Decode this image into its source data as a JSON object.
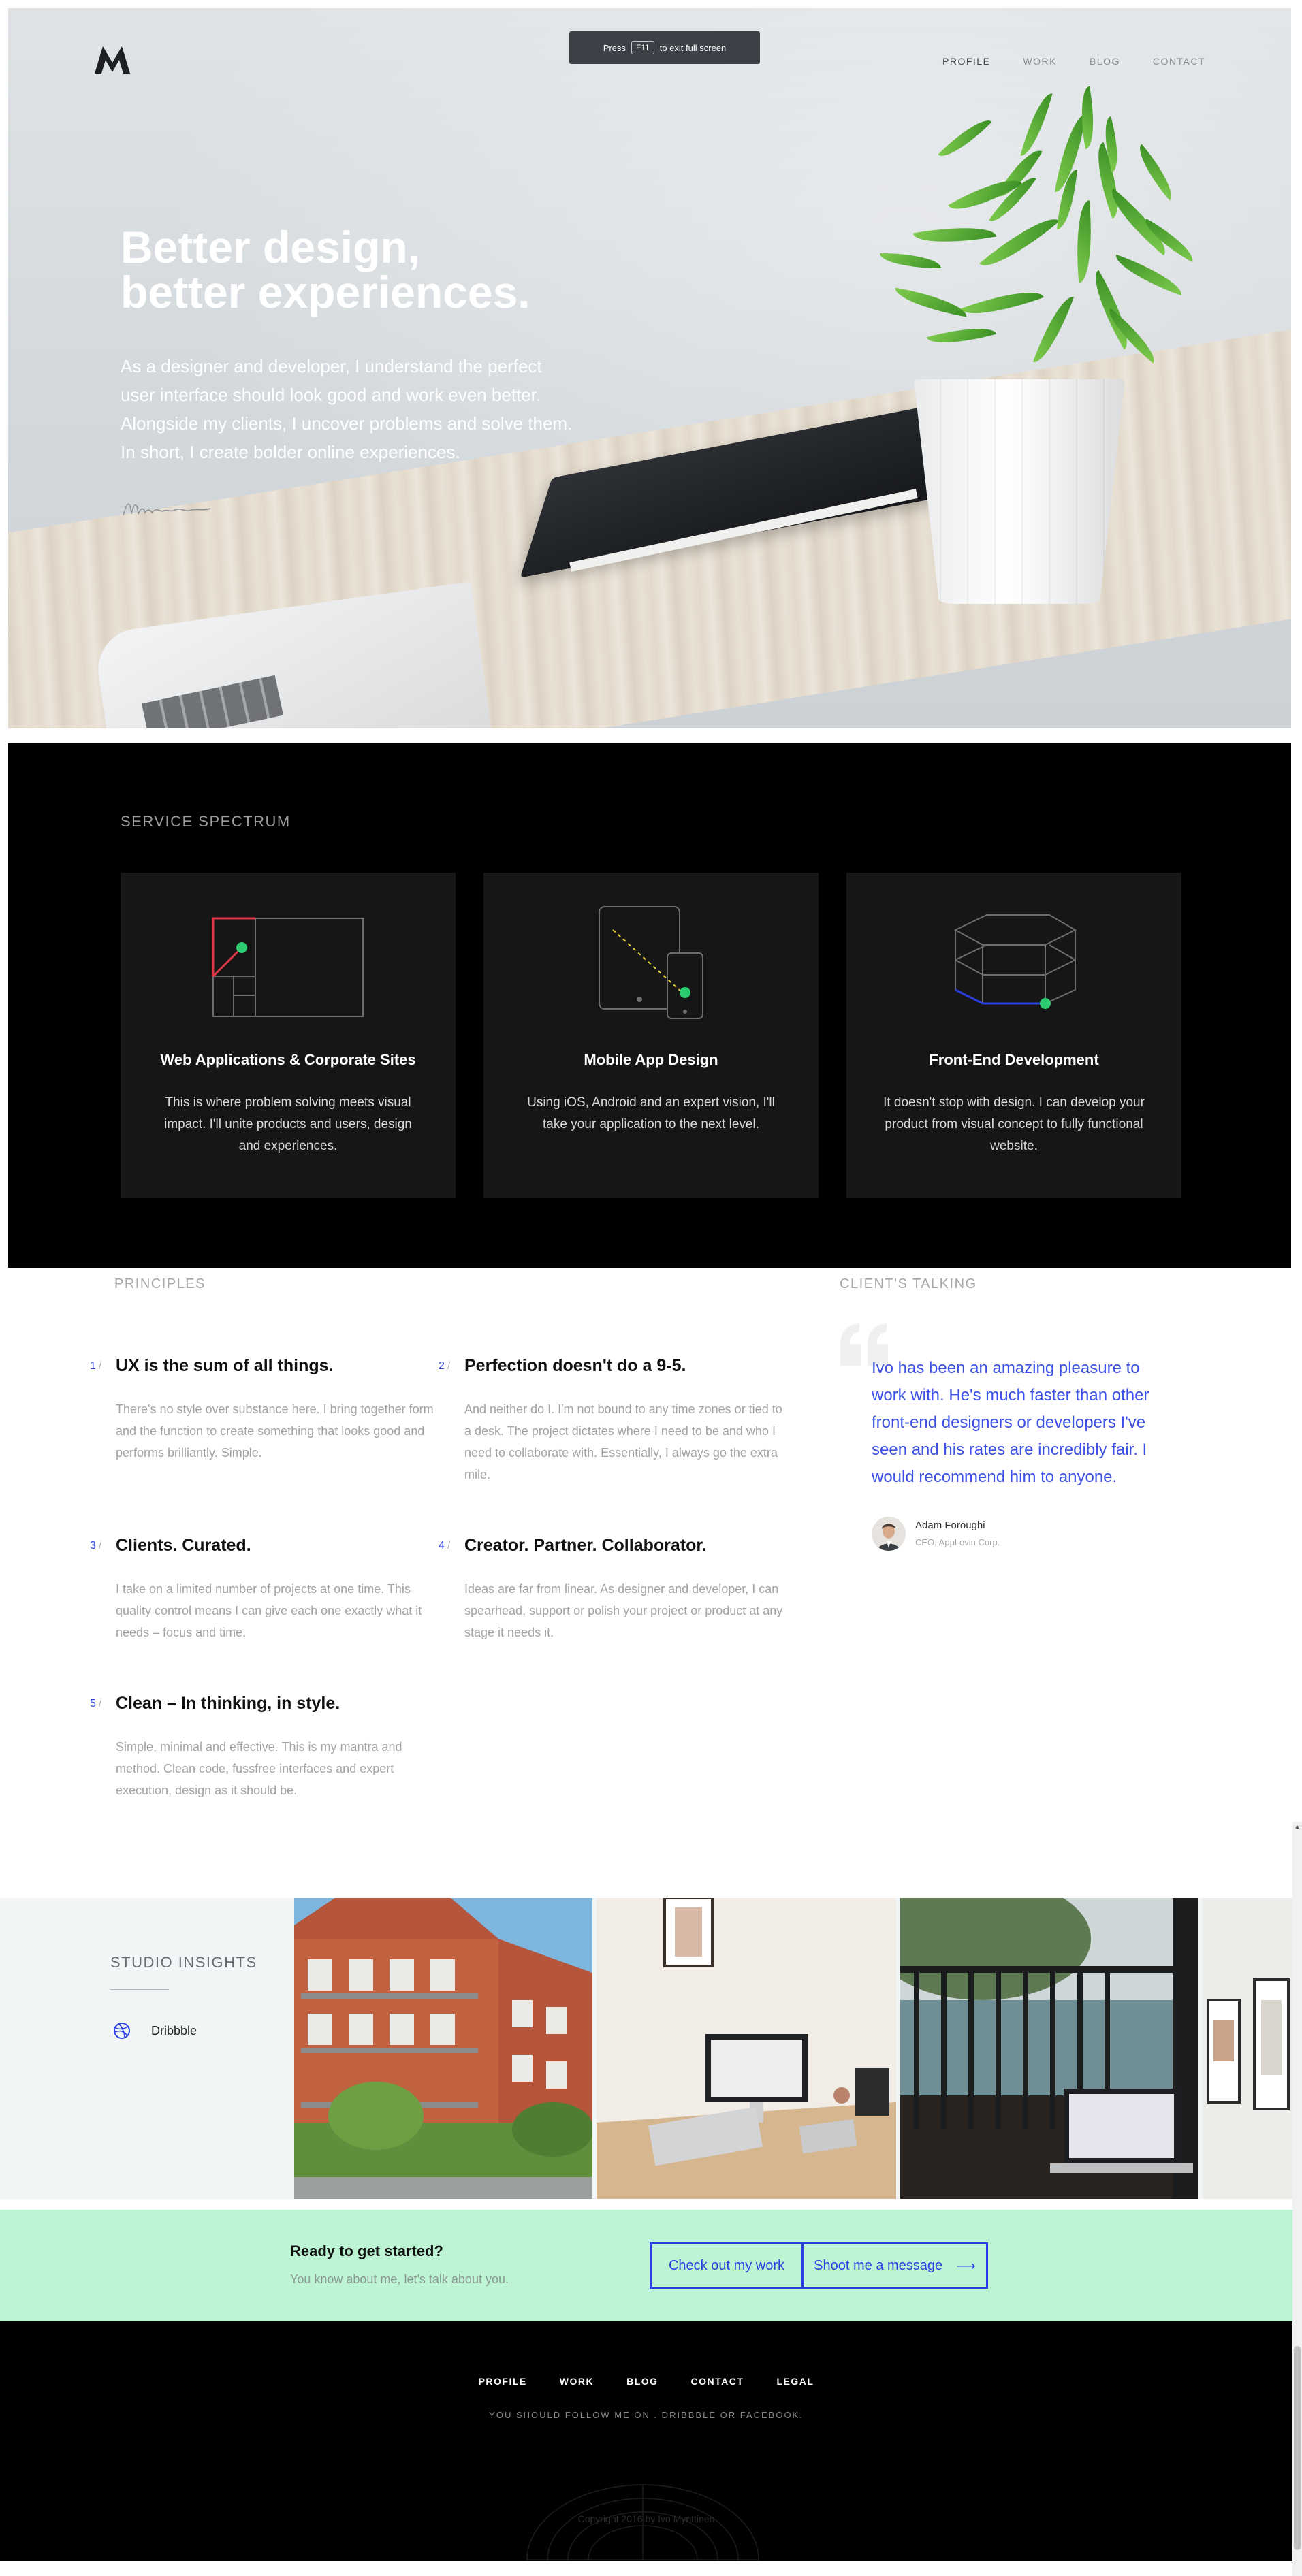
{
  "fullscreen_notice": {
    "prefix": "Press",
    "key": "F11",
    "suffix": "to exit full screen"
  },
  "nav": {
    "items": [
      "PROFILE",
      "WORK",
      "BLOG",
      "CONTACT"
    ],
    "active": "PROFILE"
  },
  "hero": {
    "title_lines": [
      "Better design,",
      "better experiences."
    ],
    "body_lines": [
      "As a designer and developer, I understand the perfect",
      "user interface should look good and work even better.",
      "Alongside my clients, I uncover problems and solve them.",
      "In short, I create bolder online experiences."
    ]
  },
  "services": {
    "title": "SERVICE SPECTRUM",
    "cards": [
      {
        "icon": "web-layout-icon",
        "name": "Web Applications & Corporate Sites",
        "desc": "This is where problem solving meets visual impact. I'll unite products and users, design and experiences."
      },
      {
        "icon": "devices-icon",
        "name": "Mobile App Design",
        "desc": "Using iOS, Android and an expert vision, I'll take your application to the next level."
      },
      {
        "icon": "cube-icon",
        "name": "Front-End Development",
        "desc": "It doesn't stop with design. I can develop your product from visual concept to fully functional website."
      }
    ]
  },
  "principles": {
    "title": "PRINCIPLES",
    "items": [
      {
        "num": "1",
        "sep": "/",
        "title": "UX is the sum of all things.",
        "body": "There's no style over substance here. I bring together form and the function to create something that looks good and performs brilliantly. Simple."
      },
      {
        "num": "2",
        "sep": "/",
        "title": "Perfection doesn't do a 9-5.",
        "body": "And neither do I. I'm not bound to any time zones or tied to a desk. The project dictates where I need to be and who I need to collaborate with. Essentially, I always go the extra mile."
      },
      {
        "num": "3",
        "sep": "/",
        "title": "Clients. Curated.",
        "body": "I take on a limited number of projects at one time. This quality control means I can give each one exactly what it needs – focus and time."
      },
      {
        "num": "4",
        "sep": "/",
        "title": "Creator. Partner. Collaborator.",
        "body": "Ideas are far from linear. As designer and developer, I can spearhead, support or polish your project or product at any stage it needs it."
      },
      {
        "num": "5",
        "sep": "/",
        "title": "Clean – In thinking, in style.",
        "body": "Simple, minimal and effective. This is my mantra and method. Clean code, fussfree interfaces and expert execution, design as it should be."
      }
    ]
  },
  "testimonial": {
    "title": "CLIENT'S TALKING",
    "quote": "Ivo has been an amazing pleasure to work with. He's much faster than other front-end designers or developers I've seen and his rates are incredibly fair. I would recommend him to anyone.",
    "author": "Adam Foroughi",
    "role": "CEO, AppLovin Corp."
  },
  "insights": {
    "title": "STUDIO INSIGHTS",
    "link": "Dribbble"
  },
  "cta": {
    "title": "Ready to get started?",
    "subtitle": "You know about me, let's talk about you.",
    "button_work": "Check out my work",
    "button_message": "Shoot me a message",
    "arrow": "⟶"
  },
  "footer": {
    "nav": [
      "PROFILE",
      "WORK",
      "BLOG",
      "CONTACT",
      "LEGAL"
    ],
    "follow": "YOU SHOULD FOLLOW ME ON . DRIBBBLE OR FACEBOOK.",
    "copyright": "Copyright 2016 by Ivo Mynttinen"
  },
  "colors": {
    "accent": "#2b3fe0",
    "green_dot": "#2ecc71",
    "red_line": "#e0374a",
    "cta_bg": "#bdf5d4"
  }
}
